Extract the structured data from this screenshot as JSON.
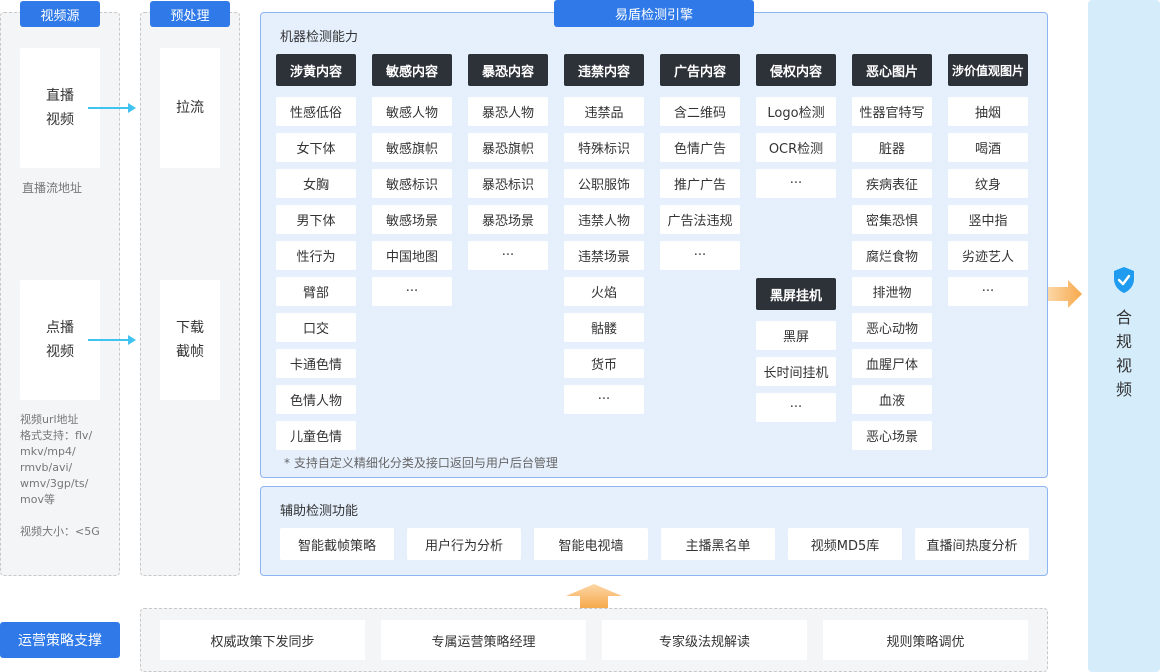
{
  "video_source": {
    "tab": "视频源",
    "live_card": "直播\n视频",
    "live_note": "直播流地址",
    "vod_card": "点播\n视频",
    "vod_note": "视频url地址\n格式支持：flv/\nmkv/mp4/\nrmvb/avi/\nwmv/3gp/ts/\nmov等",
    "vod_size": "视频大小：<5G"
  },
  "preprocess": {
    "tab": "预处理",
    "pull": "拉流",
    "download": "下载\n截帧"
  },
  "engine": {
    "title": "易盾检测引擎",
    "machine_title": "机器检测能力",
    "footnote": "* 支持自定义精细化分类及接口返回与用户后台管理",
    "categories": [
      {
        "head": "涉黄内容",
        "items": [
          "性感低俗",
          "女下体",
          "女胸",
          "男下体",
          "性行为",
          "臂部",
          "口交",
          "卡通色情",
          "色情人物",
          "儿童色情"
        ]
      },
      {
        "head": "敏感内容",
        "items": [
          "敏感人物",
          "敏感旗帜",
          "敏感标识",
          "敏感场景",
          "中国地图",
          "···"
        ]
      },
      {
        "head": "暴恐内容",
        "items": [
          "暴恐人物",
          "暴恐旗帜",
          "暴恐标识",
          "暴恐场景",
          "···"
        ]
      },
      {
        "head": "违禁内容",
        "items": [
          "违禁品",
          "特殊标识",
          "公职服饰",
          "违禁人物",
          "违禁场景",
          "火焰",
          "骷髅",
          "货币",
          "···"
        ]
      },
      {
        "head": "广告内容",
        "items": [
          "含二维码",
          "色情广告",
          "推广广告",
          "广告法违规",
          "···"
        ]
      },
      {
        "head": "侵权内容",
        "items": [
          "Logo检测",
          "OCR检测",
          "···"
        ]
      },
      {
        "head": "恶心图片",
        "items": [
          "性器官特写",
          "脏器",
          "疾病表征",
          "密集恐惧",
          "腐烂食物",
          "排泄物",
          "恶心动物",
          "血腥尸体",
          "血液",
          "恶心场景"
        ]
      },
      {
        "head": "涉价值观图片",
        "items": [
          "抽烟",
          "喝酒",
          "纹身",
          "竖中指",
          "劣迹艺人",
          "···"
        ]
      }
    ],
    "black_screen": {
      "head": "黑屏挂机",
      "items": [
        "黑屏",
        "长时间挂机",
        "···"
      ]
    },
    "aux_title": "辅助检测功能",
    "aux_items": [
      "智能截帧策略",
      "用户行为分析",
      "智能电视墙",
      "主播黑名单",
      "视频MD5库",
      "直播间热度分析"
    ]
  },
  "ops": {
    "tab": "运营策略支撑",
    "items": [
      "权威政策下发同步",
      "专属运营策略经理",
      "专家级法规解读",
      "规则策略调优"
    ]
  },
  "result": {
    "chars": [
      "合",
      "规",
      "视",
      "频"
    ],
    "icon": "shield-check-icon"
  }
}
